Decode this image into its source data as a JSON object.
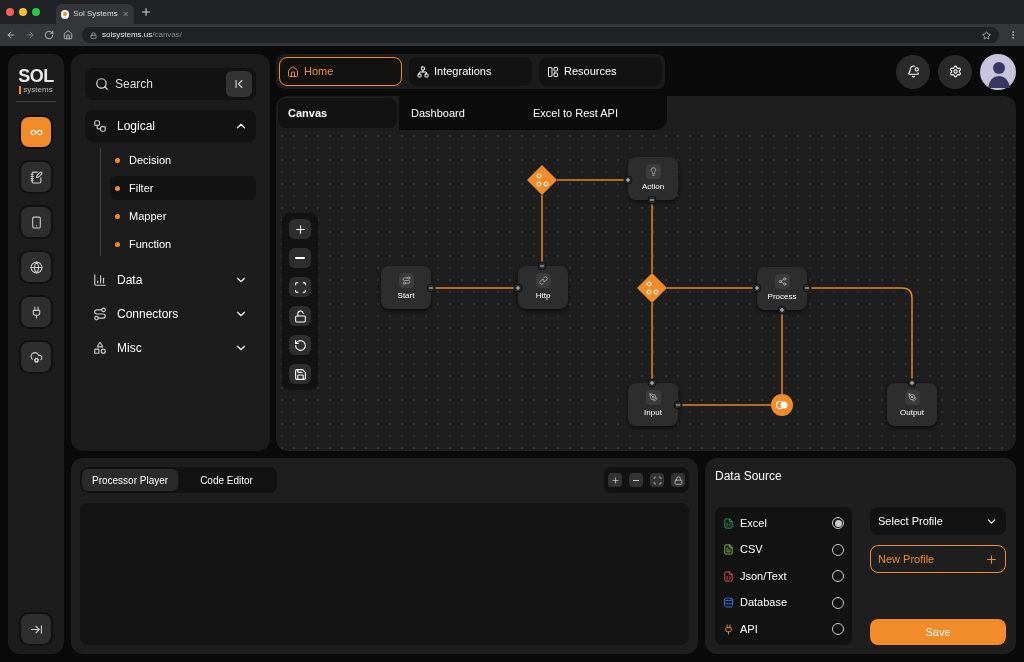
{
  "browser": {
    "tab_title": "Sol Systems",
    "url_host": "solsystems.us",
    "url_path": "/canvas/"
  },
  "logo": {
    "name": "SOL",
    "tagline": "systems"
  },
  "rail": {
    "items": [
      {
        "selected": true
      },
      {
        "selected": false
      },
      {
        "selected": false
      },
      {
        "selected": false
      },
      {
        "selected": false
      },
      {
        "selected": false
      }
    ]
  },
  "sidebar": {
    "search": {
      "placeholder": "Search"
    },
    "groups": [
      {
        "label": "Logical",
        "expanded": true,
        "children": [
          {
            "label": "Decision",
            "selected": false
          },
          {
            "label": "Filter",
            "selected": true
          },
          {
            "label": "Mapper",
            "selected": false
          },
          {
            "label": "Function",
            "selected": false
          }
        ]
      },
      {
        "label": "Data",
        "expanded": false
      },
      {
        "label": "Connectors",
        "expanded": false
      },
      {
        "label": "Misc",
        "expanded": false
      }
    ]
  },
  "nav": {
    "items": [
      {
        "label": "Home",
        "selected": true
      },
      {
        "label": "Integrations",
        "selected": false
      },
      {
        "label": "Resources",
        "selected": false
      }
    ]
  },
  "canvas": {
    "tabs": [
      {
        "label": "Canvas",
        "selected": true
      },
      {
        "label": "Dashboard",
        "selected": false
      },
      {
        "label": "Excel to Rest API",
        "selected": false
      }
    ],
    "nodes": [
      {
        "kind": "node",
        "label": "Start"
      },
      {
        "kind": "node",
        "label": "Http"
      },
      {
        "kind": "node",
        "label": "Action"
      },
      {
        "kind": "node",
        "label": "Process"
      },
      {
        "kind": "node",
        "label": "Input"
      },
      {
        "kind": "node",
        "label": "Output"
      },
      {
        "kind": "decision"
      },
      {
        "kind": "decision"
      },
      {
        "kind": "merge"
      }
    ]
  },
  "bottom": {
    "tabs": [
      {
        "label": "Processor Player",
        "selected": true
      },
      {
        "label": "Code Editor",
        "selected": false
      }
    ]
  },
  "data_source": {
    "title": "Data Source",
    "options": [
      {
        "label": "Excel",
        "selected": true
      },
      {
        "label": "CSV",
        "selected": false
      },
      {
        "label": "Json/Text",
        "selected": false
      },
      {
        "label": "Database",
        "selected": false
      },
      {
        "label": "API",
        "selected": false
      }
    ],
    "profile_select": {
      "placeholder": "Select Profile"
    },
    "new_profile": "New Profile",
    "save": "Save"
  }
}
